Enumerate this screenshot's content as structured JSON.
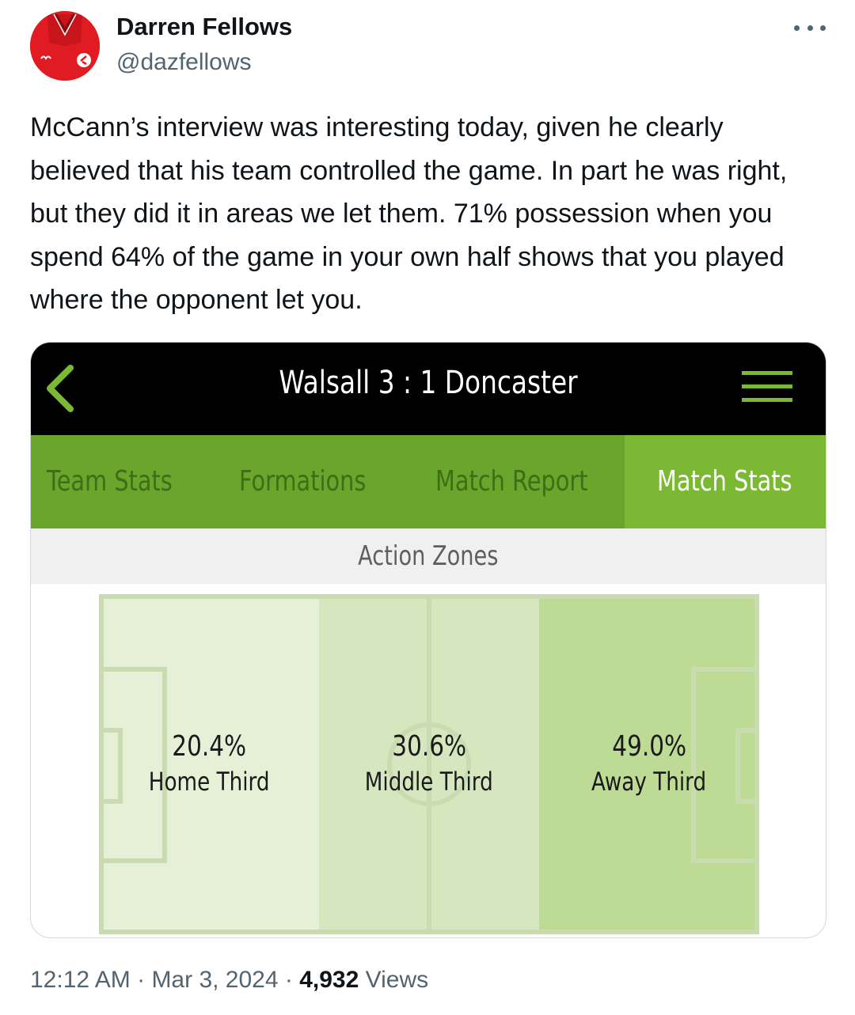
{
  "author": {
    "name": "Darren Fellows",
    "handle": "@dazfellows",
    "avatar": "red-football-shirt-avatar"
  },
  "tweet": {
    "text": "McCann’s interview was interesting today, given he clearly believed that his team controlled the game. In part he was right, but they did it in areas we let them. 71% possession when you spend 64% of the game in your own half shows that you played where the opponent let you."
  },
  "card": {
    "title": "Walsall 3 : 1 Doncaster",
    "tabs": [
      {
        "label": "Team Stats",
        "active": false
      },
      {
        "label": "Formations",
        "active": false
      },
      {
        "label": "Match Report",
        "active": false
      },
      {
        "label": "Match Stats",
        "active": true
      }
    ],
    "section_title": "Action Zones",
    "zones": [
      {
        "value": "20.4%",
        "label": "Home Third"
      },
      {
        "value": "30.6%",
        "label": "Middle Third"
      },
      {
        "value": "49.0%",
        "label": "Away Third"
      }
    ],
    "colors": {
      "header_bg": "#000000",
      "tab_bar": "#6aa52c",
      "tab_active": "#7bb833",
      "zone_home": "#e6f0d7",
      "zone_middle": "#d6e7bf",
      "zone_away": "#bddb95"
    }
  },
  "meta": {
    "time": "12:12 AM",
    "separator": " · ",
    "date": "Mar 3, 2024",
    "views_count": "4,932",
    "views_label": "Views"
  }
}
